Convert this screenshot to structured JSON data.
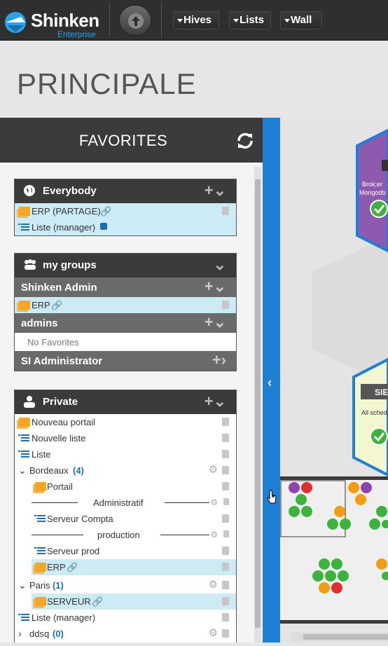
{
  "app": {
    "name": "Shinken",
    "edition": "Enterprise"
  },
  "nav": {
    "hives": "Hives",
    "lists": "Lists",
    "wall": "Wall"
  },
  "page_title": "PRINCIPALE",
  "favorites": {
    "title": "FAVORITES",
    "everybody": {
      "label": "Everybody",
      "items": [
        "ERP (PARTAGE)",
        "Liste (manager)"
      ]
    },
    "my_groups": {
      "label": "my groups",
      "shinken_admin": {
        "label": "Shinken Admin",
        "items": [
          "ERP"
        ]
      },
      "admins": {
        "label": "admins",
        "empty": "No Favorites"
      },
      "si_admin": {
        "label": "SI Administrator"
      }
    },
    "private": {
      "label": "Private",
      "items": [
        "Nouveau portail",
        "Nouvelle liste",
        "Liste"
      ],
      "bordeaux": {
        "label": "Bordeaux",
        "count": "(4)",
        "portail": "Portail",
        "sep1": "Administratif",
        "compta": "Serveur Compta",
        "sep2": "production",
        "prod": "Serveur prod",
        "erp": "ERP"
      },
      "paris": {
        "label": "Paris",
        "count": "(1)",
        "serveur": "SERVEUR"
      },
      "liste_manager": "Liste (manager)",
      "ddsq": {
        "label": "ddsq",
        "count": "(0)"
      }
    }
  },
  "hive_preview": {
    "node1_line1": "Brok;er",
    "node1_line2": "Mongodb",
    "node2_label": "SIE",
    "node2_sub": "All sched"
  },
  "colors": {
    "accent": "#1e7fd4",
    "ok": "#3db23d",
    "warn": "#f39c12",
    "crit": "#e02d2d",
    "purple": "#8e44ad"
  }
}
